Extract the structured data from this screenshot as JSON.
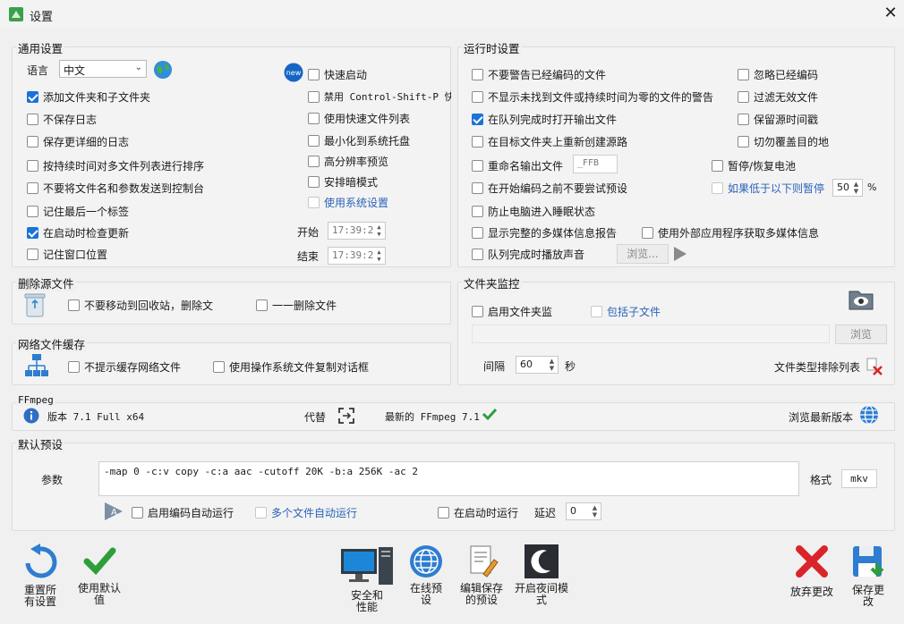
{
  "window": {
    "title": "设置"
  },
  "general": {
    "title": "通用设置",
    "language_label": "语言",
    "language_value": "中文",
    "items": [
      {
        "label": "添加文件夹和子文件夹",
        "checked": true
      },
      {
        "label": "不保存日志",
        "checked": false
      },
      {
        "label": "保存更详细的日志",
        "checked": false
      },
      {
        "label": "按持续时间对多文件列表进行排序",
        "checked": false
      },
      {
        "label": "不要将文件名和参数发送到控制台",
        "checked": false
      },
      {
        "label": "记住最后一个标签",
        "checked": false
      },
      {
        "label": "在启动时检查更新",
        "checked": true
      },
      {
        "label": "记住窗口位置",
        "checked": false
      }
    ],
    "new_badge": "new",
    "right_items": [
      {
        "label": "快速启动",
        "checked": false
      },
      {
        "label": "禁用 Control-Shift-P 快捷",
        "checked": false
      },
      {
        "label": "使用快速文件列表",
        "checked": false
      },
      {
        "label": "最小化到系统托盘",
        "checked": false
      },
      {
        "label": "高分辨率预览",
        "checked": false
      },
      {
        "label": "安排暗模式",
        "checked": false
      },
      {
        "label": "使用系统设置",
        "checked": false
      }
    ],
    "start_label": "开始",
    "start_time": "17:39:2",
    "end_label": "结束",
    "end_time": "17:39:2"
  },
  "runtime": {
    "title": "运行时设置",
    "items": [
      {
        "label": "不要警告已经编码的文件",
        "checked": false
      },
      {
        "label": "不显示未找到文件或持续时间为零的文件的警告",
        "checked": false
      },
      {
        "label": "在队列完成时打开输出文件",
        "checked": true
      },
      {
        "label": "在目标文件夹上重新创建源路",
        "checked": false
      },
      {
        "label": "重命名输出文件",
        "checked": false
      },
      {
        "label": "在开始编码之前不要尝试预设",
        "checked": false
      },
      {
        "label": "防止电脑进入睡眠状态",
        "checked": false
      },
      {
        "label": "显示完整的多媒体信息报告",
        "checked": false
      },
      {
        "label": "队列完成时播放声音",
        "checked": false
      }
    ],
    "right_items": [
      {
        "label": "忽略已经编码",
        "checked": false
      },
      {
        "label": "过滤无效文件",
        "checked": false
      },
      {
        "label": "保留源时间戳",
        "checked": false
      },
      {
        "label": "切勿覆盖目的地",
        "checked": false
      }
    ],
    "rename_suffix": "_FFB",
    "pause_battery": "暂停/恢复电池",
    "pause_below": "如果低于以下则暂停",
    "pause_percent": "50",
    "percent_sign": "%",
    "external_mediainfo": "使用外部应用程序获取多媒体信息",
    "browse_label": "浏览..."
  },
  "delete_source": {
    "title": "删除源文件",
    "opt1": "不要移动到回收站，删除文",
    "opt2": "一一删除文件"
  },
  "folder_monitor": {
    "title": "文件夹监控",
    "enable": "启用文件夹监",
    "include_sub": "包括子文件",
    "browse": "浏览",
    "interval_label": "间隔",
    "interval_value": "60",
    "seconds": "秒",
    "exclude_list": "文件类型排除列表"
  },
  "network_cache": {
    "title": "网络文件缓存",
    "opt1": "不提示缓存网络文件",
    "opt2": "使用操作系统文件复制对话框"
  },
  "ffmpeg": {
    "title": "FFmpeg",
    "version": "版本 7.1 Full  x64",
    "replace": "代替",
    "latest": "最新的 FFmpeg 7.1",
    "browse_latest": "浏览最新版本"
  },
  "default_preset": {
    "title": "默认预设",
    "params_label": "参数",
    "params_value": "-map 0 -c:v copy -c:a aac -cutoff 20K -b:a 256K -ac 2",
    "format_label": "格式",
    "format_value": "mkv",
    "auto_run": "启用编码自动运行",
    "multi_auto": "多个文件自动运行",
    "run_on_start": "在启动时运行",
    "delay_label": "延迟",
    "delay_value": "0"
  },
  "bottom": {
    "reset": "重置所\n有设置",
    "use_default": "使用默认\n值",
    "security": "安全和\n性能",
    "online_presets": "在线预\n设",
    "edit_saved": "编辑保存\n的预设",
    "night_mode": "开启夜间模\n式",
    "discard": "放弃更改",
    "save": "保存更\n改"
  },
  "colors": {
    "accent": "#1a73d6",
    "link_blue": "#2a63b8",
    "check_green": "#2e9e3a",
    "discard_red": "#d9252a"
  }
}
